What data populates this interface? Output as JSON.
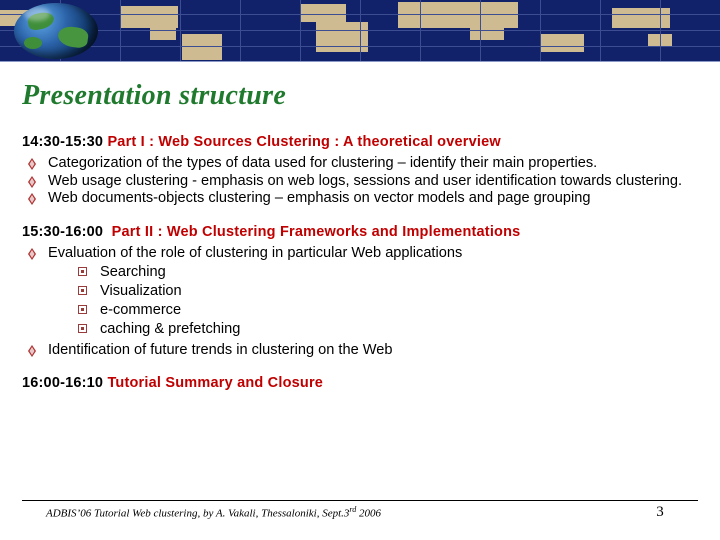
{
  "slide": {
    "title": "Presentation structure",
    "page_number": "3"
  },
  "banner": {
    "bg_color": "#11226b",
    "land_color": "#cfbb91",
    "logo_name": "globe-logo"
  },
  "sections": [
    {
      "time": "14:30-15:30",
      "heading": "Part I : Web Sources Clustering : A theoretical overview",
      "heading_color": "#c00000",
      "items": [
        {
          "text": "Categorization of the types of data used for clustering – identify their main properties.",
          "sub": []
        },
        {
          "text": "Web usage clustering - emphasis on web logs, sessions and user identification towards clustering.",
          "sub": []
        },
        {
          "text": "Web documents-objects clustering – emphasis on vector models and page grouping",
          "sub": []
        }
      ]
    },
    {
      "time": "15:30-16:00",
      "heading": "Part II : Web Clustering Frameworks and Implementations",
      "heading_color": "#c00000",
      "items": [
        {
          "text": "Evaluation of the role of clustering in particular Web applications",
          "sub": [
            "Searching",
            "Visualization",
            "e-commerce",
            "caching & prefetching"
          ]
        },
        {
          "text": "Identification of future trends in clustering on the Web",
          "sub": []
        }
      ]
    },
    {
      "time": "16:00-16:10",
      "heading": "Tutorial Summary and Closure",
      "heading_color": "#c00000",
      "items": []
    }
  ],
  "footer": {
    "text_before": "ADBIS’06 Tutorial Web clustering, by A. Vakali, Thessaloniki, Sept.3",
    "text_sup": "rd",
    "text_after": " 2006"
  }
}
